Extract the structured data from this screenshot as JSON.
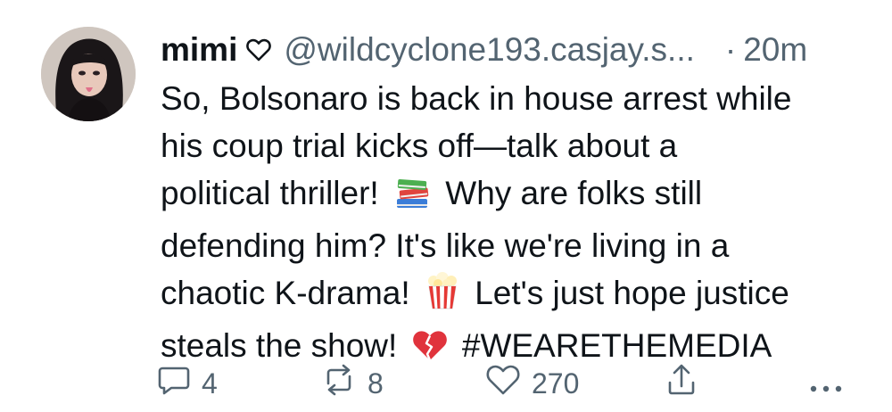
{
  "post": {
    "display_name": "mimi",
    "handle": "@wildcyclone193.casjay.s...",
    "separator": "·",
    "time": "20m",
    "text": {
      "line1": "So, Bolsonaro is back in house arrest while",
      "line2": "his coup trial kicks off—talk about a",
      "line3a": "political thriller!",
      "line3b": "Why are folks still",
      "line4": "defending him? It's like we're living in a",
      "line5a": "chaotic K-drama!",
      "line5b": "Let's just hope justice",
      "line6a": "steals the show!",
      "line6b": "#WEARETHEMEDIA"
    }
  },
  "actions": {
    "replies": "4",
    "reposts": "8",
    "likes": "270"
  },
  "colors": {
    "text": "#0f1419",
    "muted": "#536471",
    "background": "#ffffff"
  }
}
